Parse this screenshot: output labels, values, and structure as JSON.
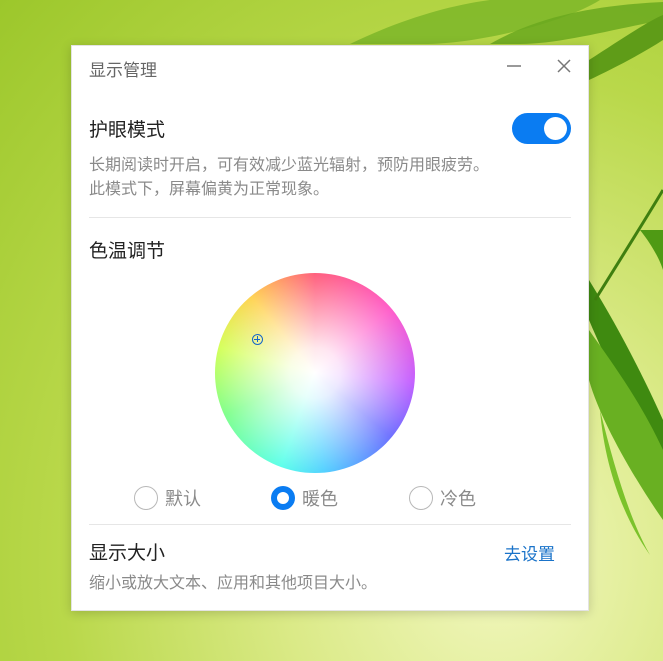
{
  "dialog": {
    "title": "显示管理",
    "minimize_icon": "minimize-icon",
    "close_icon": "close-icon"
  },
  "eye_protection": {
    "title": "护眼模式",
    "enabled": true,
    "description_line1": "长期阅读时开启，可有效减少蓝光辐射，预防用眼疲劳。",
    "description_line2": "此模式下，屏幕偏黄为正常现象。"
  },
  "color_temperature": {
    "title": "色温调节",
    "options": [
      {
        "label": "默认",
        "checked": false
      },
      {
        "label": "暖色",
        "checked": true
      },
      {
        "label": "冷色",
        "checked": false
      }
    ]
  },
  "display_size": {
    "title": "显示大小",
    "link": "去设置",
    "description": "缩小或放大文本、应用和其他项目大小。"
  },
  "colors": {
    "accent": "#0a7cf2",
    "link": "#1a73c9"
  }
}
